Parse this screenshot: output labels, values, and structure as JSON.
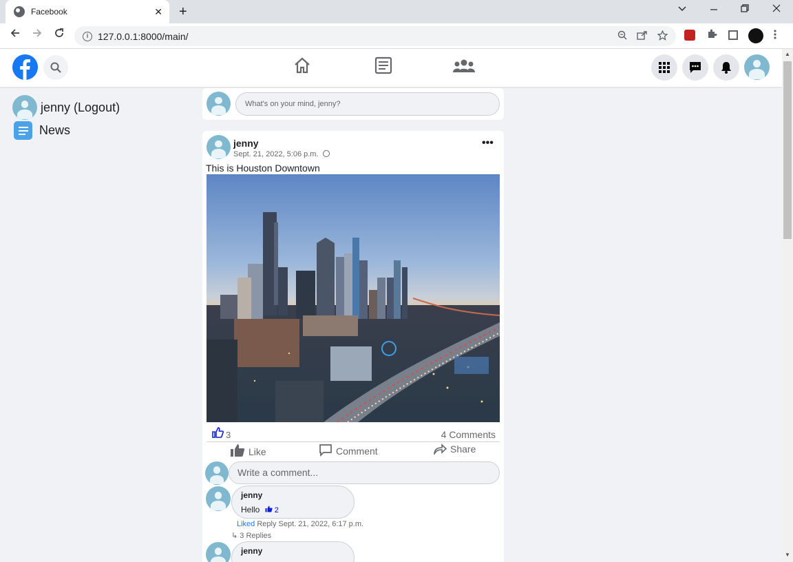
{
  "browser": {
    "tab_title": "Facebook",
    "tab_close": "✕",
    "new_tab": "+",
    "url": "127.0.0.1:8000/main/"
  },
  "user": {
    "name": "jenny",
    "sidebar_label": "jenny (Logout)"
  },
  "sidebar": {
    "news_label": "News"
  },
  "composer": {
    "placeholder": "What's on your mind, jenny?"
  },
  "post": {
    "author": "jenny",
    "date": "Sept. 21, 2022, 5:06 p.m.",
    "more": "•••",
    "text": "This is Houston Downtown",
    "like_count": "3",
    "comments_label": "4 Comments",
    "actions": {
      "like": "Like",
      "comment": "Comment",
      "share": "Share"
    },
    "comment_placeholder": "Write a comment..."
  },
  "comments": [
    {
      "author": "jenny",
      "text": "Hello",
      "likes": "2",
      "liked_label": "Liked",
      "reply_label": "Reply",
      "date": "Sept. 21, 2022, 6:17 p.m.",
      "replies_label": "↳ 3 Replies"
    },
    {
      "author": "jenny"
    }
  ],
  "colors": {
    "brand": "#1877f2",
    "avatar": "#7fb8cf",
    "background": "#f0f2f5"
  }
}
